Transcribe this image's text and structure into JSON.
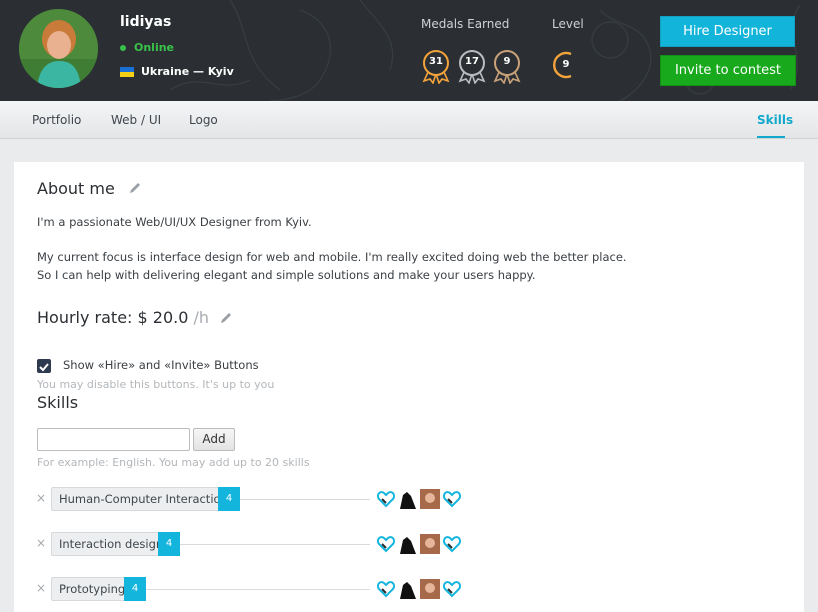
{
  "profile": {
    "username": "lidiyas",
    "status": "Online",
    "location": "Ukraine — Kyiv"
  },
  "stats": {
    "medals_label": "Medals Earned",
    "level_label": "Level",
    "medals": [
      "31",
      "17",
      "9"
    ],
    "level": "9"
  },
  "actions": {
    "hire_label": "Hire Designer",
    "invite_label": "Invite to contest"
  },
  "nav": {
    "tabs": [
      {
        "label": "Portfolio"
      },
      {
        "label": "Web / UI"
      },
      {
        "label": "Logo"
      },
      {
        "label": "Skills"
      }
    ],
    "active": "Skills"
  },
  "about": {
    "title": "About me",
    "paragraphs": [
      "I'm a passionate Web/UI/UX Designer from Kyiv.",
      "My current focus is interface design for web and mobile. I'm really excited doing web the better place.",
      "So I can help with delivering elegant and simple solutions and make your users happy."
    ]
  },
  "rate": {
    "label": "Hourly rate:",
    "value": "$ 20.0",
    "unit": "/h"
  },
  "buttons_toggle": {
    "label": "Show «Hire» and «Invite» Buttons",
    "hint": "You may disable this buttons. It's up to you",
    "checked": true
  },
  "skills": {
    "title": "Skills",
    "input_value": "",
    "add_label": "Add",
    "hint": "For example: English. You may add up to 20 skills",
    "items": [
      {
        "remove": "×",
        "name": "Human-Computer Interaction",
        "count": "4"
      },
      {
        "remove": "×",
        "name": "Interaction design",
        "count": "4"
      },
      {
        "remove": "×",
        "name": "Prototyping",
        "count": "4"
      }
    ]
  },
  "colors": {
    "accent": "#12b4d9",
    "invite": "#18a91c",
    "online": "#39c24a",
    "medal": "#f2a33a",
    "header_bg": "#2b2f33"
  }
}
